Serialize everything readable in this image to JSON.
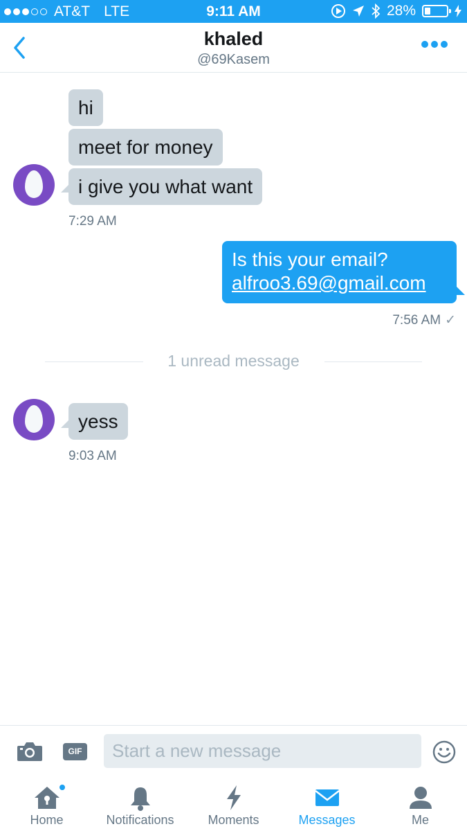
{
  "status_bar": {
    "carrier": "AT&T",
    "network": "LTE",
    "time": "9:11 AM",
    "battery": "28%",
    "battery_level": 0.28
  },
  "header": {
    "title": "khaled",
    "handle": "@69Kasem"
  },
  "conversation": {
    "group1": {
      "messages": [
        "hi",
        "meet for money",
        "i give you what want"
      ],
      "time": "7:29 AM"
    },
    "outgoing": {
      "text": "Is this your email?",
      "link": "alfroo3.69@gmail.com",
      "time": "7:56 AM",
      "check": "✓"
    },
    "unread_label": "1 unread message",
    "group2": {
      "messages": [
        "yess"
      ],
      "time": "9:03 AM"
    }
  },
  "composer": {
    "gif_label": "GIF",
    "placeholder": "Start a new message"
  },
  "tabs": [
    {
      "label": "Home",
      "icon": "home-icon"
    },
    {
      "label": "Notifications",
      "icon": "bell-icon"
    },
    {
      "label": "Moments",
      "icon": "lightning-icon"
    },
    {
      "label": "Messages",
      "icon": "envelope-icon"
    },
    {
      "label": "Me",
      "icon": "person-icon"
    }
  ],
  "colors": {
    "accent": "#1da1f2",
    "incoming_bubble": "#ccd6dd",
    "avatar": "#794bc4",
    "inactive_icon": "#657786"
  }
}
